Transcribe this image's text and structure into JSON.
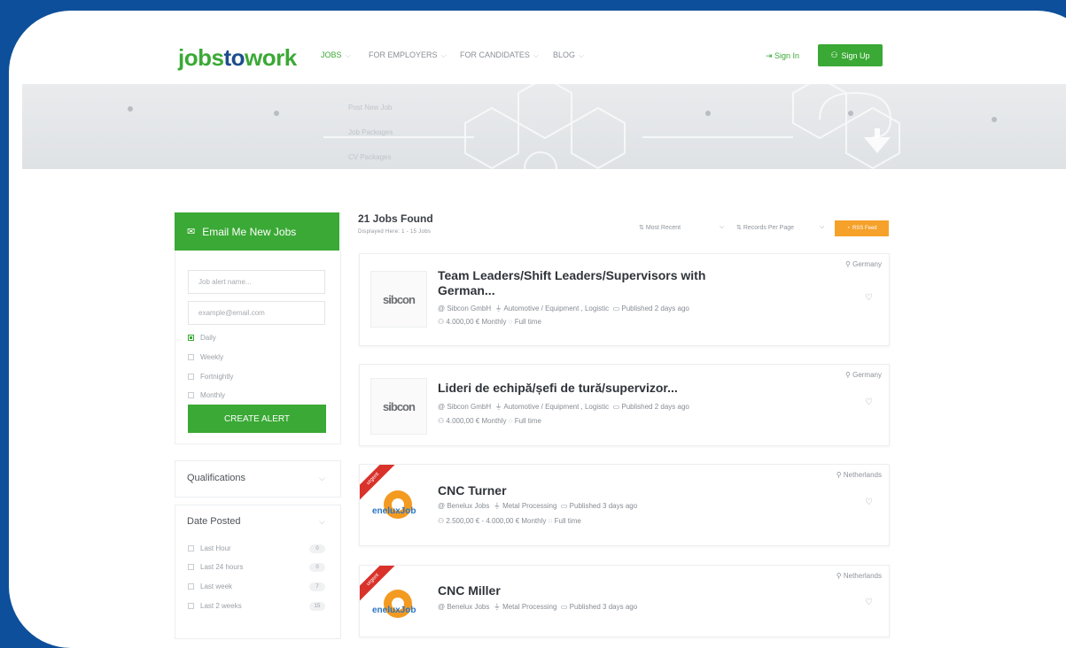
{
  "brand": {
    "part1": "jobs",
    "part2": "to",
    "part3": "work"
  },
  "nav": {
    "items": [
      {
        "label": "JOBS"
      },
      {
        "label": "FOR EMPLOYERS"
      },
      {
        "label": "FOR CANDIDATES"
      },
      {
        "label": "BLOG"
      }
    ],
    "dropdown": [
      "Post New Job",
      "Job Packages",
      "CV Packages"
    ],
    "sign_in": "Sign In",
    "sign_up": "Sign Up"
  },
  "sidebar": {
    "alert_title": "Email Me New Jobs",
    "name_placeholder": "Job alert name...",
    "email_placeholder": "example@email.com",
    "frequency": [
      "Daily",
      "Weekly",
      "Fortnightly",
      "Monthly"
    ],
    "frequency_selected": "Daily",
    "create_alert": "CREATE ALERT",
    "qualifications": "Qualifications",
    "date_posted": "Date Posted",
    "date_options": [
      {
        "label": "Last Hour",
        "count": "0"
      },
      {
        "label": "Last 24 hours",
        "count": "0"
      },
      {
        "label": "Last week",
        "count": "7"
      },
      {
        "label": "Last 2 weeks",
        "count": "15"
      }
    ]
  },
  "results": {
    "found": "21 Jobs Found",
    "displayed": "Displayed Here: 1 - 15 Jobs",
    "sort": "Most Recent",
    "per_page": "Records Per Page",
    "rss": "RSS Feed"
  },
  "jobs": [
    {
      "title": "Team Leaders/Shift Leaders/Supervisors with German...",
      "company": "@ Sibcon GmbH",
      "category": "Automotive / Equipment , Logistic",
      "published": "Published 2 days ago",
      "salary": "4.000,00 € Monthly",
      "type": "Full time",
      "location": "Germany",
      "logo_text": "sibcon"
    },
    {
      "title": "Lideri de echipă/șefi de tură/supervizor...",
      "company": "@ Sibcon GmbH",
      "category": "Automotive / Equipment , Logistic",
      "published": "Published 2 days ago",
      "salary": "4.000,00 € Monthly",
      "type": "Full time",
      "location": "Germany",
      "logo_text": "sibcon"
    },
    {
      "title": "CNC Turner",
      "company": "@ Benelux Jobs",
      "category": "Metal Processing",
      "published": "Published 3 days ago",
      "salary": "2.500,00 € - 4.000,00 € Monthly",
      "type": "Full time",
      "location": "Netherlands",
      "badge": "urgent",
      "logo_text": "eneluxJob"
    },
    {
      "title": "CNC Miller",
      "company": "@ Benelux Jobs",
      "category": "Metal Processing",
      "published": "Published 3 days ago",
      "location": "Netherlands",
      "badge": "urgent",
      "logo_text": "eneluxJob"
    }
  ],
  "colors": {
    "brand_green": "#3aa935",
    "brand_blue": "#1c4d8c",
    "background": "#0d4f9a",
    "rss": "#f5a12a",
    "urgent": "#d9322b"
  }
}
